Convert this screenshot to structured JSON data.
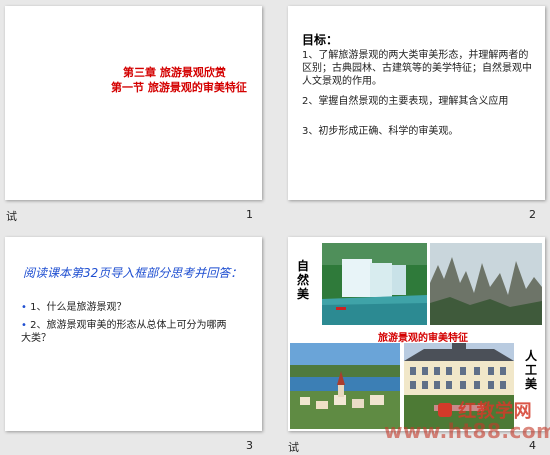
{
  "slides": [
    {
      "number": "1",
      "cap": "试",
      "title_line1": "第三章 旅游景观欣赏",
      "title_line2": "第一节 旅游景观的审美特征"
    },
    {
      "number": "2",
      "heading": "目标：",
      "items": [
        "1、了解旅游景观的两大类审美形态，并理解两者的区别；古典园林、古建筑等的美学特征；自然景观中人文景观的作用。",
        "2、掌握自然景观的主要表现，理解其含义应用",
        "3、初步形成正确、科学的审美观。"
      ]
    },
    {
      "number": "3",
      "heading": "阅读课本第32页导入框部分思考并回答：",
      "bullets": [
        "1、什么是旅游景观？",
        "2、旅游景观审美的形态从总体上可分为哪两大类？"
      ]
    },
    {
      "number": "4",
      "cap": "试",
      "left_label": "自然美",
      "right_label": "人工美",
      "caption": "旅游景观的审美特征",
      "watermark_brand": "红教学网",
      "watermark_url": "www.ht88.com"
    }
  ],
  "colors": {
    "title_red": "#d40000",
    "heading_blue": "#1f4fd1"
  }
}
